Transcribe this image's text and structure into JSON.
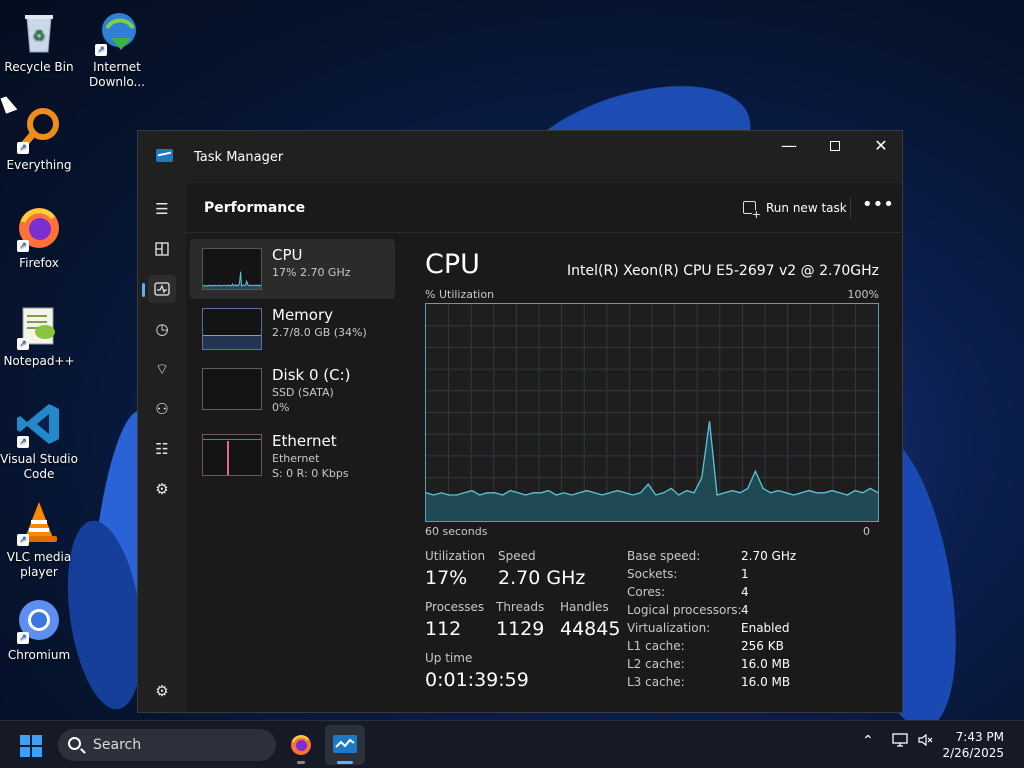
{
  "desktop": {
    "icons": [
      {
        "label": "Recycle Bin",
        "icon": "recycle-bin-icon"
      },
      {
        "label": "Internet Downlo...",
        "icon": "internet-download-manager-icon"
      },
      {
        "label": "Everything",
        "icon": "everything-search-icon"
      },
      {
        "label": "Firefox",
        "icon": "firefox-icon"
      },
      {
        "label": "Notepad++",
        "icon": "notepad-plus-plus-icon"
      },
      {
        "label": "Visual Studio Code",
        "icon": "vscode-icon"
      },
      {
        "label": "VLC media player",
        "icon": "vlc-icon"
      },
      {
        "label": "Chromium",
        "icon": "chromium-icon"
      }
    ]
  },
  "window": {
    "title": "Task Manager",
    "controls": {
      "minimize": "—",
      "close": "✕"
    }
  },
  "nav": {
    "active": "Performance",
    "icons": [
      "hamburger-menu-icon",
      "processes-icon",
      "performance-icon",
      "app-history-icon",
      "startup-apps-icon",
      "users-icon",
      "details-icon",
      "services-icon",
      "settings-icon"
    ]
  },
  "cmdbar": {
    "page_title": "Performance",
    "run_new_task": "Run new task",
    "more": "•••"
  },
  "devices": [
    {
      "name": "CPU",
      "line1": "17% 2.70 GHz",
      "line2": ""
    },
    {
      "name": "Memory",
      "line1": "2.7/8.0 GB (34%)",
      "line2": ""
    },
    {
      "name": "Disk 0 (C:)",
      "line1": "SSD (SATA)",
      "line2": "0%"
    },
    {
      "name": "Ethernet",
      "line1": "Ethernet",
      "line2": "S: 0 R: 0 Kbps"
    }
  ],
  "detail": {
    "heading": "CPU",
    "cpu_model": "Intel(R) Xeon(R) CPU E5-2697 v2 @ 2.70GHz",
    "graph_label_left": "% Utilization",
    "graph_label_right": "100%",
    "axis_left": "60 seconds",
    "axis_right": "0",
    "utilization_series": [
      13,
      12,
      13,
      12,
      12,
      13,
      14,
      12,
      13,
      13,
      12,
      14,
      13,
      12,
      13,
      13,
      14,
      12,
      13,
      12,
      13,
      14,
      13,
      12,
      13,
      14,
      13,
      12,
      13,
      17,
      12,
      13,
      15,
      12,
      14,
      13,
      20,
      46,
      12,
      13,
      14,
      13,
      15,
      23,
      15,
      13,
      14,
      13,
      12,
      13,
      14,
      13,
      13,
      14,
      13,
      12,
      14,
      13,
      15,
      13
    ]
  },
  "stats": {
    "utilization_label": "Utilization",
    "utilization": "17%",
    "speed_label": "Speed",
    "speed": "2.70 GHz",
    "processes_label": "Processes",
    "processes": "112",
    "threads_label": "Threads",
    "threads": "1129",
    "handles_label": "Handles",
    "handles": "44845",
    "uptime_label": "Up time",
    "uptime": "0:01:39:59"
  },
  "specs": [
    {
      "k": "Base speed:",
      "v": "2.70 GHz"
    },
    {
      "k": "Sockets:",
      "v": "1"
    },
    {
      "k": "Cores:",
      "v": "4"
    },
    {
      "k": "Logical processors:",
      "v": "4"
    },
    {
      "k": "Virtualization:",
      "v": "Enabled"
    },
    {
      "k": "L1 cache:",
      "v": "256 KB"
    },
    {
      "k": "L2 cache:",
      "v": "16.0 MB"
    },
    {
      "k": "L3 cache:",
      "v": "16.0 MB"
    }
  ],
  "taskbar": {
    "search_placeholder": "Search",
    "apps": [
      "firefox-icon",
      "task-manager-icon"
    ],
    "time": "7:43 PM",
    "date": "2/26/2025"
  }
}
